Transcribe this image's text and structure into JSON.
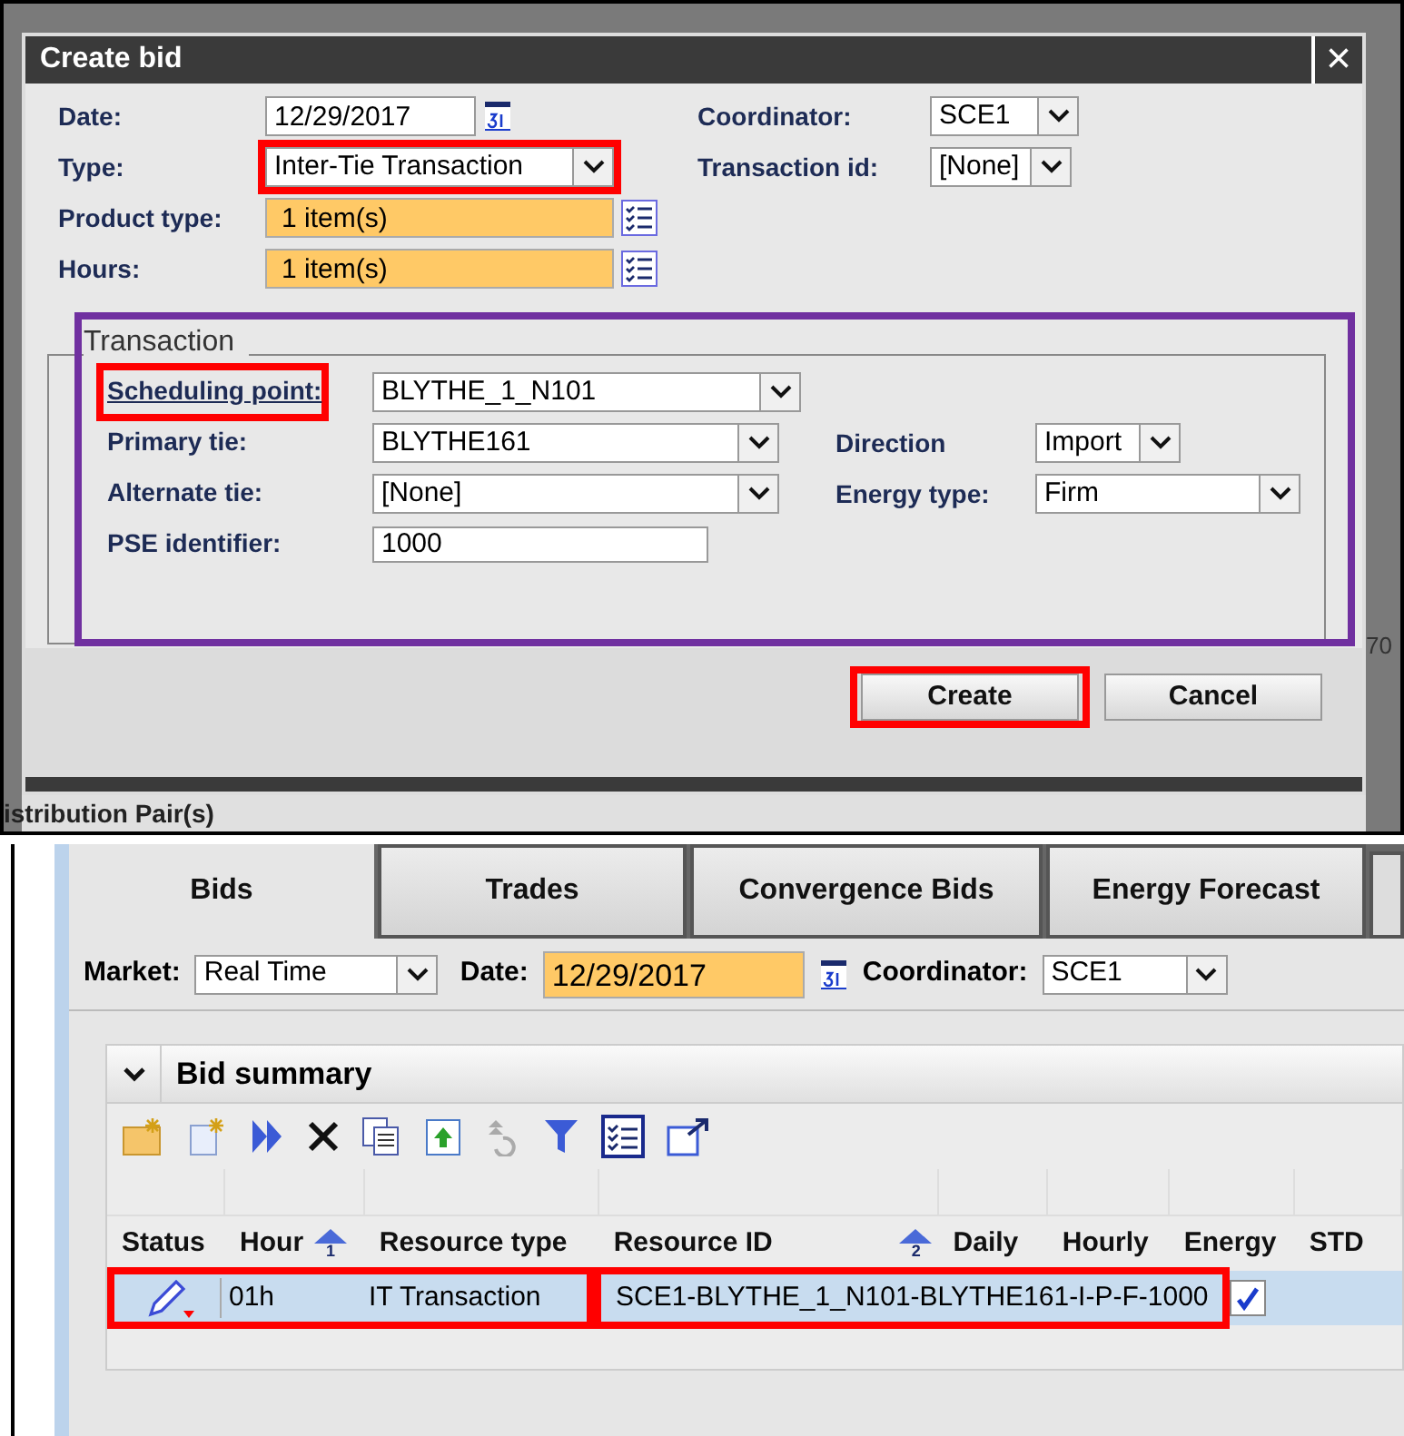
{
  "dialog": {
    "title": "Create bid",
    "close": "×",
    "fields_left": [
      {
        "kind": "date",
        "label": "Date:",
        "value": "12/29/2017",
        "highlighted": false
      },
      {
        "kind": "select",
        "label": "Type:",
        "value": "Inter-Tie Transaction",
        "highlighted": true
      },
      {
        "kind": "picker",
        "label": "Product type:",
        "value": "1 item(s)",
        "highlighted": false
      },
      {
        "kind": "picker",
        "label": "Hours:",
        "value": "1 item(s)",
        "highlighted": false
      }
    ],
    "fields_right": [
      {
        "label": "Coordinator:",
        "value": "SCE1"
      },
      {
        "label": "Transaction id:",
        "value": "[None]"
      }
    ],
    "transaction": {
      "legend": "Transaction",
      "highlighted": true,
      "rows": [
        {
          "label": "Scheduling point:",
          "value": "BLYTHE_1_N101",
          "kind": "select",
          "underlined": true,
          "highlighted": true
        },
        {
          "label": "Primary tie:",
          "value": "BLYTHE161",
          "kind": "select",
          "underlined": false,
          "highlighted": false,
          "right_label": "Direction",
          "right_value": "Import"
        },
        {
          "label": "Alternate tie:",
          "value": "[None]",
          "kind": "select",
          "underlined": false,
          "highlighted": false,
          "right_label": "Energy type:",
          "right_value": "Firm"
        },
        {
          "label": "PSE identifier:",
          "value": "1000",
          "kind": "text",
          "underlined": false,
          "highlighted": false
        }
      ]
    },
    "buttons": [
      {
        "label": "Create",
        "highlighted": true
      },
      {
        "label": "Cancel",
        "highlighted": false
      }
    ]
  },
  "background_text": {
    "behind_label": "istribution Pair(s)",
    "behind_value": "70"
  },
  "tabs": [
    {
      "label": "Bids",
      "selected": true
    },
    {
      "label": "Trades",
      "selected": false
    },
    {
      "label": "Convergence Bids",
      "selected": false
    },
    {
      "label": "Energy Forecast",
      "selected": false
    }
  ],
  "filters": {
    "market_label": "Market:",
    "market": "Real Time",
    "date_label": "Date:",
    "date": "12/29/2017",
    "coordinator_label": "Coordinator:",
    "coordinator": "SCE1"
  },
  "bid_summary": {
    "title": "Bid summary",
    "expanded": true,
    "columns": [
      {
        "label": "Status"
      },
      {
        "label": "Hour",
        "sort_rank": "1"
      },
      {
        "label": "Resource type"
      },
      {
        "label": "Resource ID",
        "sort_rank": "2"
      },
      {
        "label": "Daily"
      },
      {
        "label": "Hourly"
      },
      {
        "label": "Energy"
      },
      {
        "label": "STD"
      }
    ],
    "rows": [
      {
        "hour": "01h",
        "resource_type": "IT Transaction",
        "resource_id": "SCE1-BLYTHE_1_N101-BLYTHE161-I-P-F-1000",
        "std": true,
        "highlighted": true
      }
    ]
  }
}
